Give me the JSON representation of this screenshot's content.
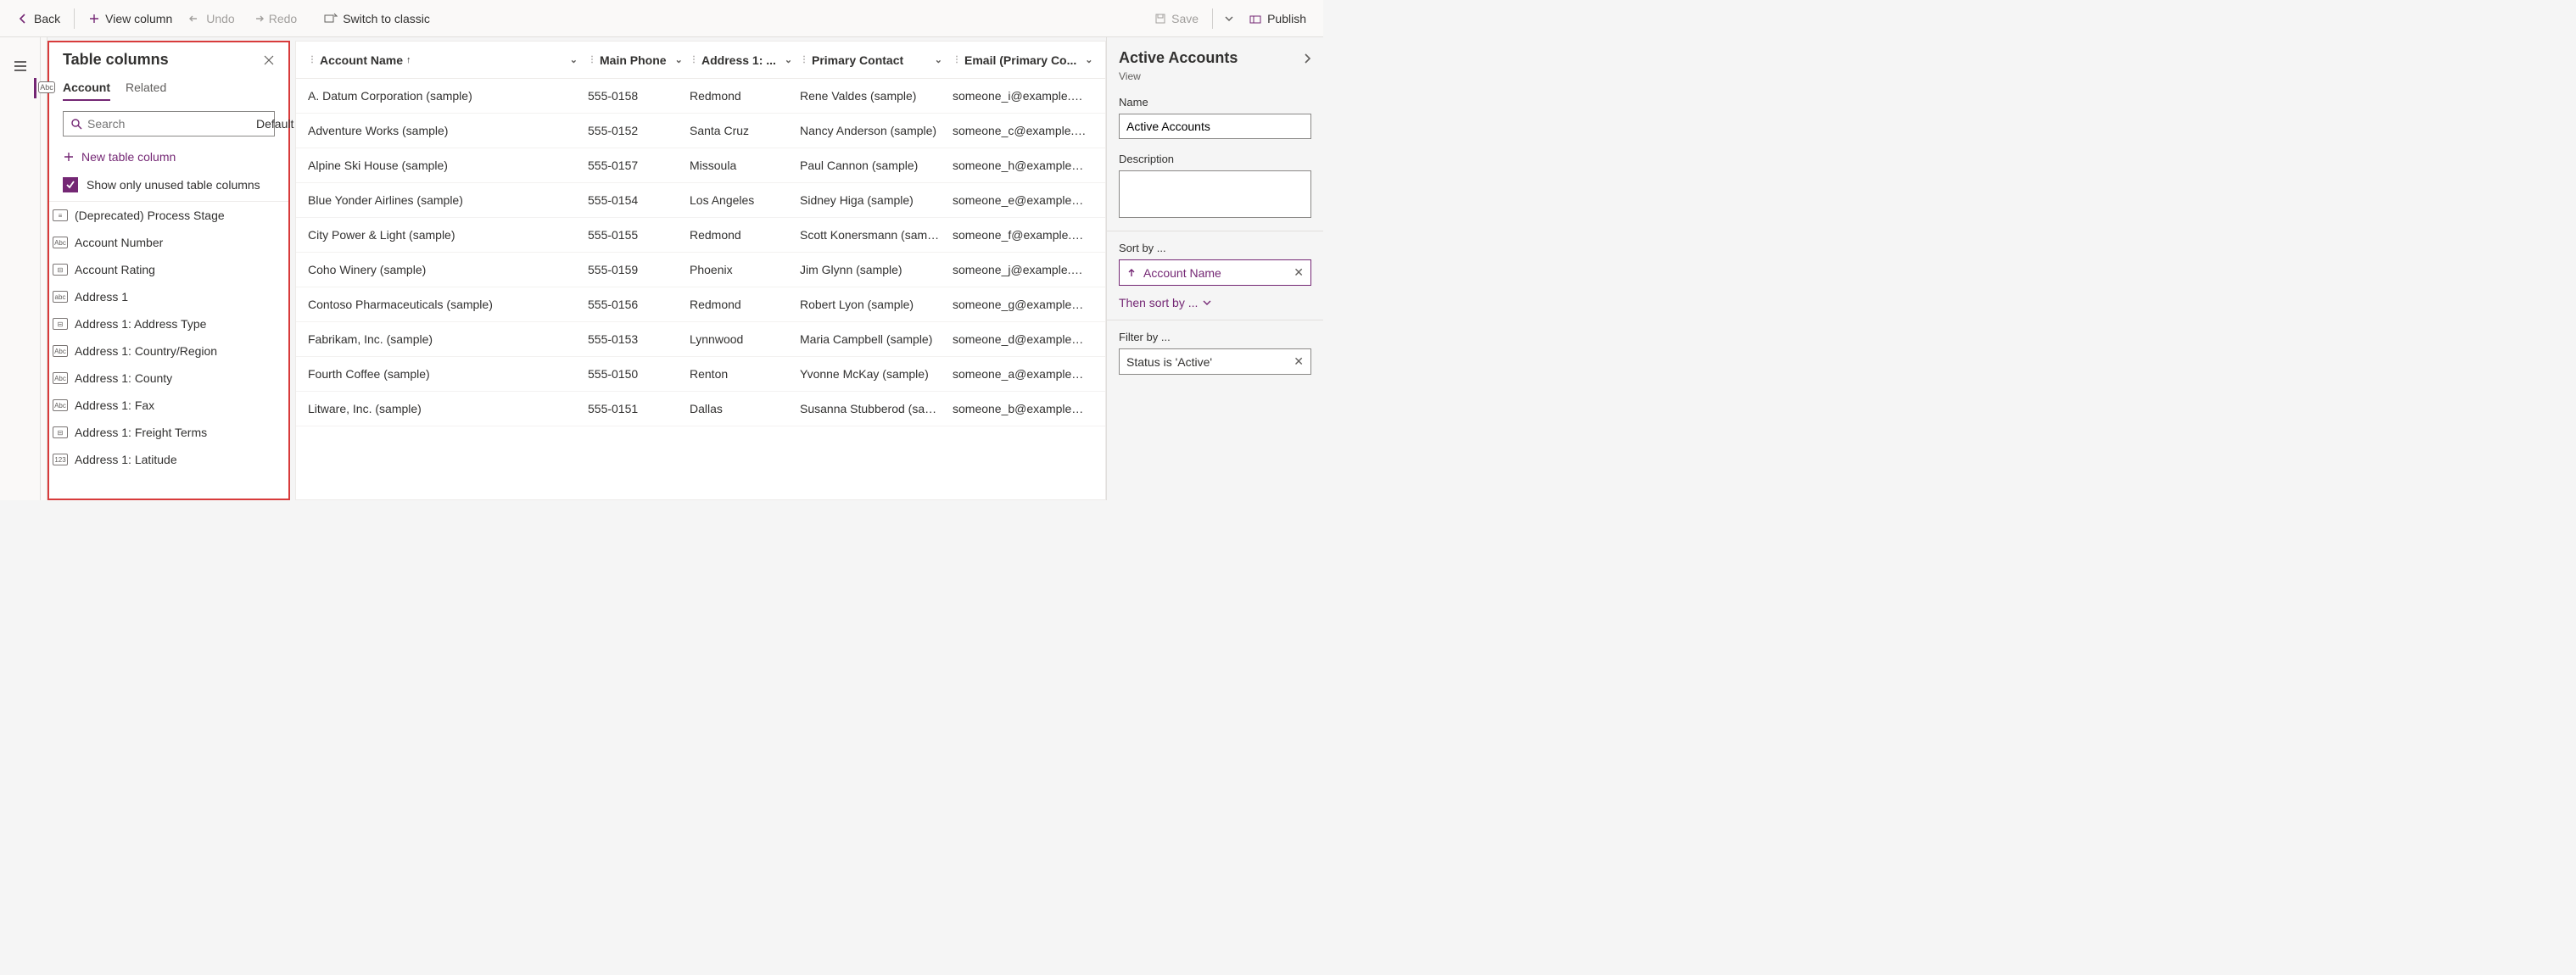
{
  "toolbar": {
    "back": "Back",
    "view_column": "View column",
    "undo": "Undo",
    "redo": "Redo",
    "switch_classic": "Switch to classic",
    "save": "Save",
    "publish": "Publish"
  },
  "panel": {
    "title": "Table columns",
    "tab_account": "Account",
    "tab_related": "Related",
    "search_placeholder": "Search",
    "default_label": "Default",
    "new_column": "New table column",
    "show_unused": "Show only unused table columns",
    "columns": [
      {
        "icon": "≡",
        "label": "(Deprecated) Process Stage"
      },
      {
        "icon": "Abc",
        "label": "Account Number"
      },
      {
        "icon": "⊟",
        "label": "Account Rating"
      },
      {
        "icon": "abc",
        "label": "Address 1"
      },
      {
        "icon": "⊟",
        "label": "Address 1: Address Type"
      },
      {
        "icon": "Abc",
        "label": "Address 1: Country/Region"
      },
      {
        "icon": "Abc",
        "label": "Address 1: County"
      },
      {
        "icon": "Abc",
        "label": "Address 1: Fax"
      },
      {
        "icon": "⊟",
        "label": "Address 1: Freight Terms"
      },
      {
        "icon": "123",
        "label": "Address 1: Latitude"
      }
    ]
  },
  "table": {
    "headers": {
      "name": "Account Name",
      "phone": "Main Phone",
      "addr": "Address 1: ...",
      "contact": "Primary Contact",
      "email": "Email (Primary Co..."
    },
    "rows": [
      {
        "name": "A. Datum Corporation (sample)",
        "phone": "555-0158",
        "addr": "Redmond",
        "contact": "Rene Valdes (sample)",
        "email": "someone_i@example.com"
      },
      {
        "name": "Adventure Works (sample)",
        "phone": "555-0152",
        "addr": "Santa Cruz",
        "contact": "Nancy Anderson (sample)",
        "email": "someone_c@example.com"
      },
      {
        "name": "Alpine Ski House (sample)",
        "phone": "555-0157",
        "addr": "Missoula",
        "contact": "Paul Cannon (sample)",
        "email": "someone_h@example.com"
      },
      {
        "name": "Blue Yonder Airlines (sample)",
        "phone": "555-0154",
        "addr": "Los Angeles",
        "contact": "Sidney Higa (sample)",
        "email": "someone_e@example.com"
      },
      {
        "name": "City Power & Light (sample)",
        "phone": "555-0155",
        "addr": "Redmond",
        "contact": "Scott Konersmann (sample)",
        "email": "someone_f@example.com"
      },
      {
        "name": "Coho Winery (sample)",
        "phone": "555-0159",
        "addr": "Phoenix",
        "contact": "Jim Glynn (sample)",
        "email": "someone_j@example.com"
      },
      {
        "name": "Contoso Pharmaceuticals (sample)",
        "phone": "555-0156",
        "addr": "Redmond",
        "contact": "Robert Lyon (sample)",
        "email": "someone_g@example.com"
      },
      {
        "name": "Fabrikam, Inc. (sample)",
        "phone": "555-0153",
        "addr": "Lynnwood",
        "contact": "Maria Campbell (sample)",
        "email": "someone_d@example.com"
      },
      {
        "name": "Fourth Coffee (sample)",
        "phone": "555-0150",
        "addr": "Renton",
        "contact": "Yvonne McKay (sample)",
        "email": "someone_a@example.com"
      },
      {
        "name": "Litware, Inc. (sample)",
        "phone": "555-0151",
        "addr": "Dallas",
        "contact": "Susanna Stubberod (samp...",
        "email": "someone_b@example.com"
      }
    ]
  },
  "side": {
    "title": "Active Accounts",
    "subtype": "View",
    "name_label": "Name",
    "name_value": "Active Accounts",
    "desc_label": "Description",
    "sort_label": "Sort by ...",
    "sort_value": "Account Name",
    "then_sort": "Then sort by ...",
    "filter_label": "Filter by ...",
    "filter_value": "Status is 'Active'"
  }
}
